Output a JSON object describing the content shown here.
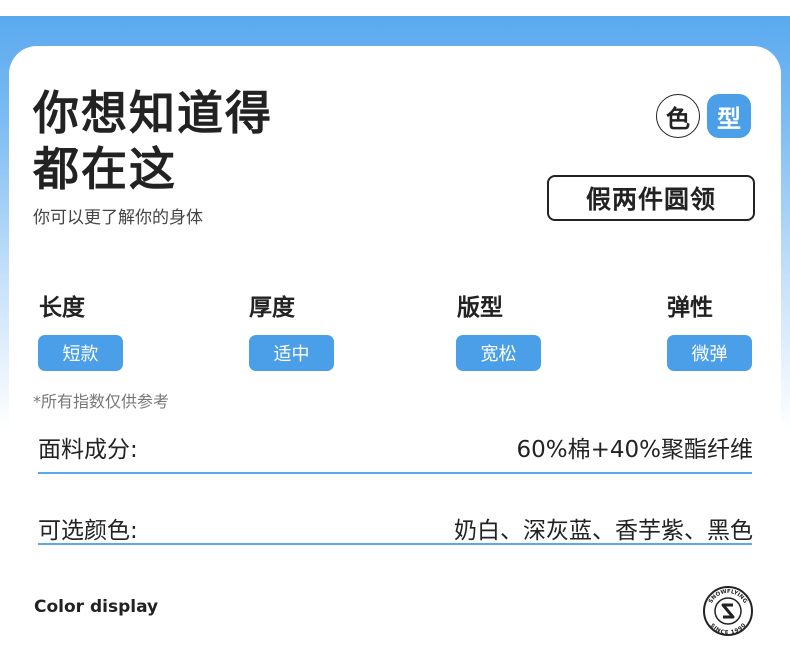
{
  "headline": {
    "line1": "你想知道得",
    "line2": "都在这"
  },
  "subtitle": "你可以更了解你的身体",
  "badges": {
    "color": "色",
    "type": "型"
  },
  "style_name": "假两件圆领",
  "attributes": [
    {
      "label": "长度",
      "value": "短款"
    },
    {
      "label": "厚度",
      "value": "适中"
    },
    {
      "label": "版型",
      "value": "宽松"
    },
    {
      "label": "弹性",
      "value": "微弹"
    }
  ],
  "note": "*所有指数仅供参考",
  "fabric": {
    "label": "面料成分:",
    "value": "60%棉+40%聚酯纤维"
  },
  "colors": {
    "label": "可选颜色:",
    "value": "奶白、深灰蓝、香芋紫、黑色"
  },
  "color_display": "Color display",
  "logo": {
    "top_text": "SNOWFLYING",
    "bottom_text": "SINCE 1990"
  },
  "theme": {
    "accent": "#4a9fe8",
    "band": "#5aa9ef"
  }
}
